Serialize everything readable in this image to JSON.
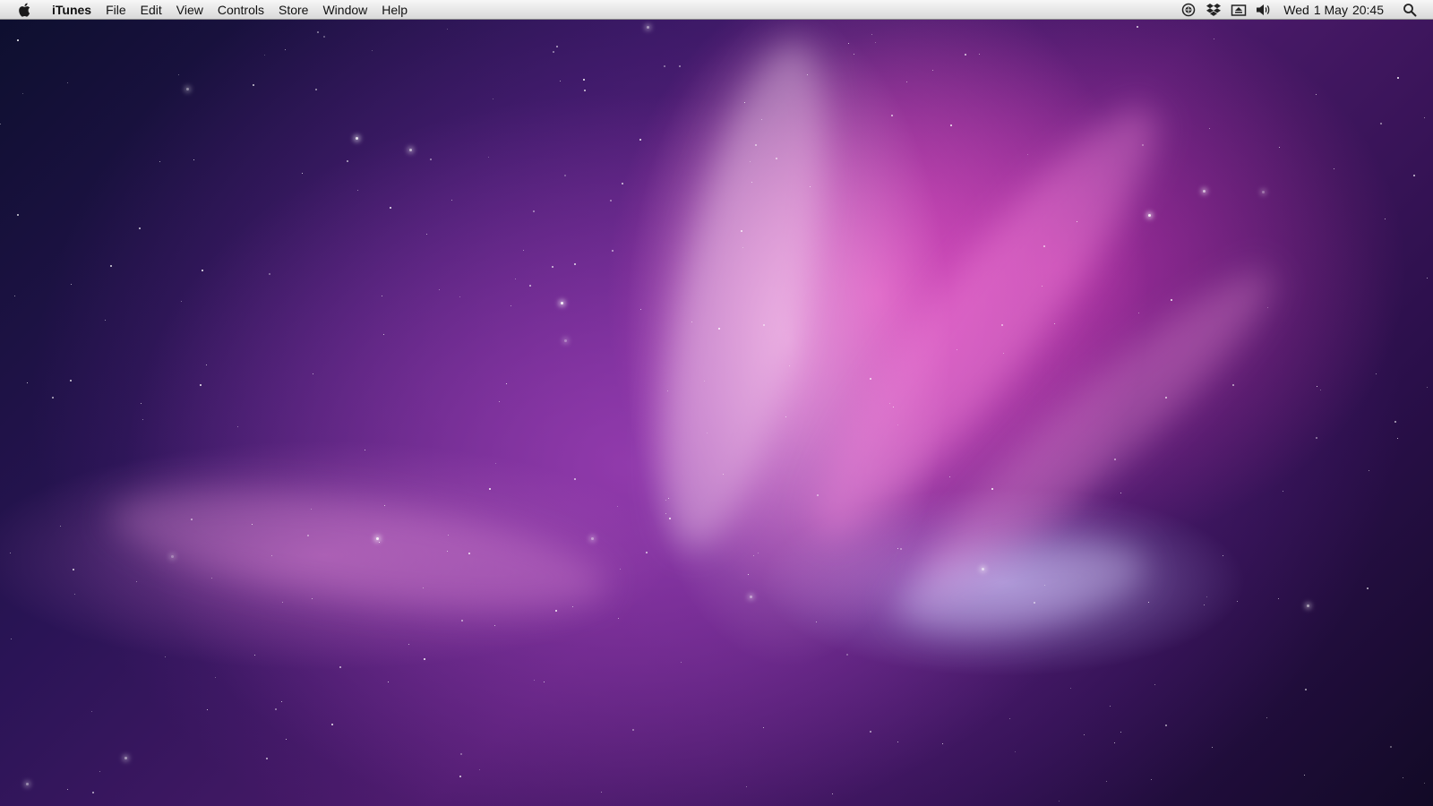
{
  "menubar": {
    "apple_menu_icon": "apple-logo-icon",
    "app_name": "iTunes",
    "items": [
      "File",
      "Edit",
      "View",
      "Controls",
      "Store",
      "Window",
      "Help"
    ],
    "status_icons": [
      "sync-icon",
      "dropbox-icon",
      "eject-icon",
      "volume-icon"
    ],
    "clock": {
      "day": "Wed",
      "date": "1 May",
      "time": "20:45"
    },
    "spotlight_icon": "spotlight-search-icon"
  },
  "desktop": {
    "wallpaper_colors": [
      "#0d0f2e",
      "#2a1456",
      "#4b1a6a",
      "#e85ac8",
      "#ffd7f5"
    ]
  }
}
